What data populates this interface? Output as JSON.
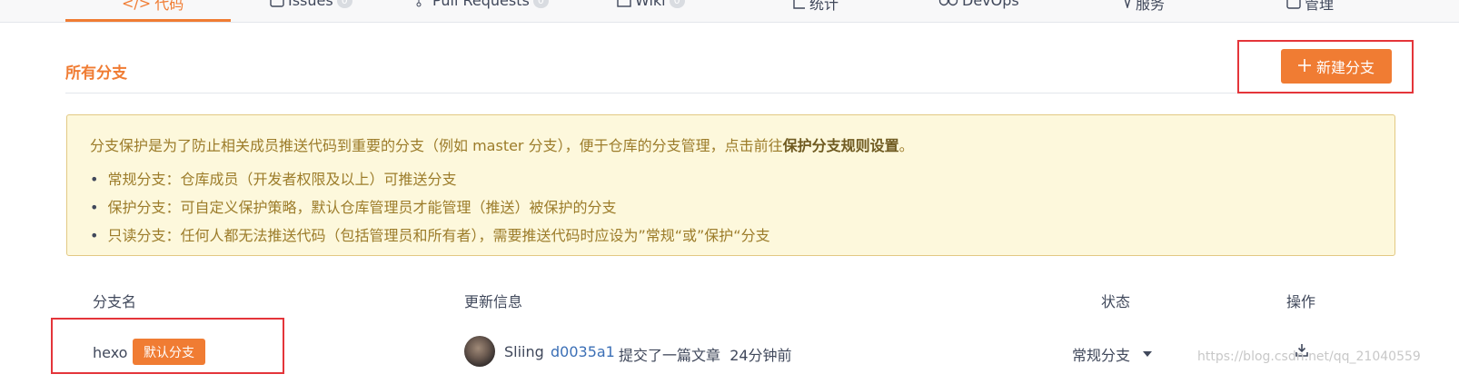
{
  "nav": {
    "tabs": [
      {
        "label": "代码",
        "active": true
      },
      {
        "label": "Issues",
        "count": "0"
      },
      {
        "label": "Pull Requests",
        "count": "0"
      },
      {
        "label": "Wiki",
        "count": "0"
      },
      {
        "label": "统计"
      },
      {
        "label": "DevOps"
      },
      {
        "label": "服务"
      },
      {
        "label": "管理"
      }
    ]
  },
  "section": {
    "title": "所有分支",
    "new_branch_label": "新建分支"
  },
  "notice": {
    "intro": "分支保护是为了防止相关成员推送代码到重要的分支（例如 master 分支），便于仓库的分支管理，点击前往",
    "link": "保护分支规则设置",
    "intro_end": "。",
    "items": [
      "常规分支：仓库成员（开发者权限及以上）可推送分支",
      "保护分支：可自定义保护策略，默认仓库管理员才能管理（推送）被保护的分支",
      "只读分支：任何人都无法推送代码（包括管理员和所有者），需要推送代码时应设为”常规“或”保护“分支"
    ]
  },
  "table": {
    "headers": {
      "name": "分支名",
      "update": "更新信息",
      "status": "状态",
      "actions": "操作"
    },
    "rows": [
      {
        "name": "hexo",
        "badge": "默认分支",
        "author": "Sliing",
        "commit": "d0035a1",
        "message": "提交了一篇文章",
        "time": "24分钟前",
        "status": "常规分支"
      }
    ]
  },
  "watermark": "https://blog.csdn.net/qq_21040559",
  "colors": {
    "accent": "#f07c33",
    "highlight": "#e4353a",
    "notice_bg": "#fdf8dc",
    "link": "#3b6fb6"
  }
}
